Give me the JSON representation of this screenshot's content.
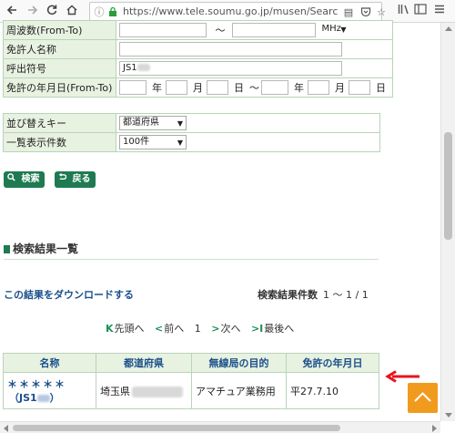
{
  "browser": {
    "url_host": "https://www.tele.soumu.go.jp",
    "url_path": "/musen/SearchS"
  },
  "form": {
    "freq_label": "周波数(From-To)",
    "freq_sep": "～",
    "freq_unit": "MHz",
    "licensee_label": "免許人名称",
    "callsign_label": "呼出符号",
    "callsign_value": "JS1",
    "date_label": "免許の年月日(From-To)",
    "year": "年",
    "month": "月",
    "day": "日",
    "date_sep": "～"
  },
  "options": {
    "sort_label": "並び替えキー",
    "sort_value": "都道府県",
    "display_label": "一覧表示件数",
    "display_value": "100件"
  },
  "buttons": {
    "search": "検索",
    "back": "戻る"
  },
  "results_section": {
    "title": "検索結果一覧",
    "download_link": "この結果をダウンロードする",
    "count_label": "検索結果件数",
    "count_value": "1 ～ 1 / 1"
  },
  "pager": {
    "first": "先頭へ",
    "prev": "前へ",
    "page": "1",
    "next": "次へ",
    "last": "最後へ"
  },
  "table": {
    "headers": [
      "名称",
      "都道府県",
      "無線局の目的",
      "免許の年月日"
    ],
    "row": {
      "name_line1": "＊＊＊＊＊",
      "name_line2": "（JS1",
      "name_line2_end": "）",
      "prefecture": "埼玉県",
      "purpose": "アマチュア業務用",
      "date": "平27.7.10"
    }
  },
  "colors": {
    "accent": "#1f7a52",
    "label_bg": "#e8f2e1",
    "link": "#1a4f8a",
    "top_button": "#f19b1e",
    "annotation_arrow": "#e8141c"
  }
}
